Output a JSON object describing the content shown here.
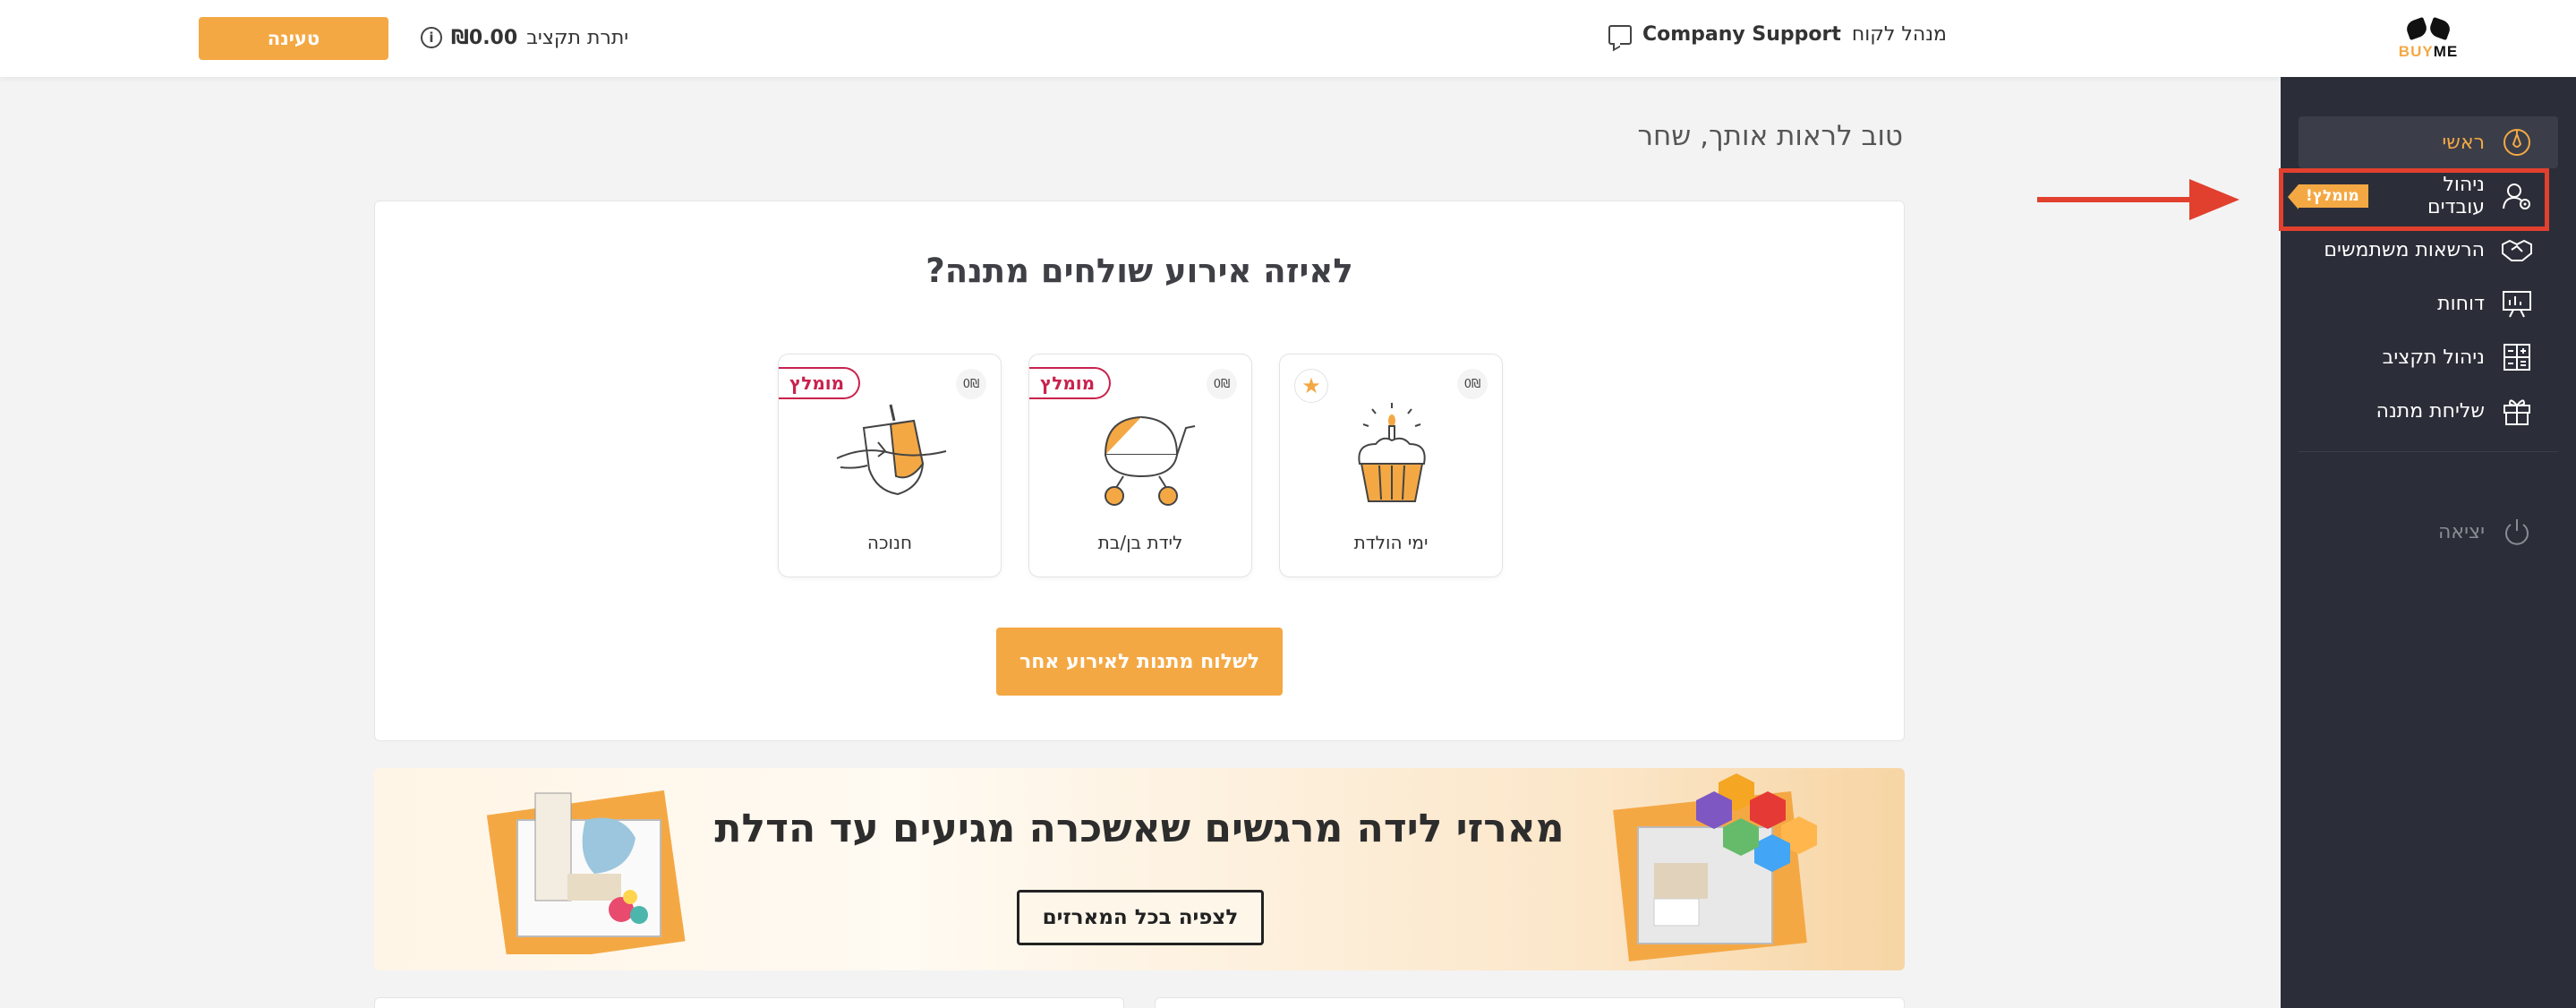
{
  "header": {
    "topup_label": "טעינה",
    "budget_label": "יתרת תקציב",
    "budget_amount": "₪0.00",
    "client_role": "מנהל לקוח",
    "client_name": "Company Support"
  },
  "logo": {
    "buy": "BUY",
    "me": "ME"
  },
  "sidebar": {
    "items": [
      {
        "label": "ראשי",
        "icon": "compass-icon",
        "active": true
      },
      {
        "label": "ניהול עובדים",
        "icon": "user-gear-icon",
        "badge": "מומלץ!"
      },
      {
        "label": "הרשאות משתמשים",
        "icon": "handshake-icon"
      },
      {
        "label": "דוחות",
        "icon": "presentation-chart-icon"
      },
      {
        "label": "ניהול תקציב",
        "icon": "calculator-icon"
      },
      {
        "label": "שליחת מתנה",
        "icon": "gift-icon"
      }
    ],
    "exit_label": "יציאה"
  },
  "main": {
    "greeting": "טוב לראות אותך, שחר",
    "card_title": "לאיזה אירוע שולחים מתנה?",
    "events": [
      {
        "label": "ימי הולדת",
        "price": "0₪",
        "marker": "star-icon"
      },
      {
        "label": "לידת בן/בת",
        "price": "0₪",
        "ribbon": "מומלץ"
      },
      {
        "label": "חנוכה",
        "price": "0₪",
        "ribbon": "מומלץ"
      }
    ],
    "other_event_button": "לשלוח מתנות לאירוע אחר"
  },
  "banner": {
    "title": "מארזי לידה מרגשים שאשכרה מגיעים עד הדלת",
    "button": "לצפיה בכל המארזים"
  },
  "colors": {
    "accent": "#f4a844",
    "sidebar_bg": "#2b2e38",
    "highlight": "#e2402f",
    "ribbon": "#c9224d"
  }
}
